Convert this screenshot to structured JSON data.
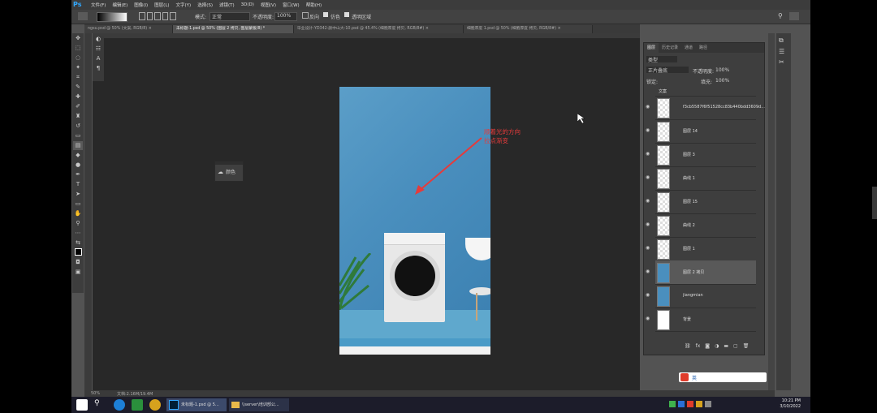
{
  "app": {
    "name": "Ps"
  },
  "menu": [
    "文件(F)",
    "编辑(E)",
    "图像(I)",
    "图层(L)",
    "文字(Y)",
    "选择(S)",
    "滤镜(T)",
    "3D(D)",
    "视图(V)",
    "窗口(W)",
    "帮助(H)"
  ],
  "options": {
    "mode_label": "模式:",
    "mode_value": "正常",
    "opacity_label": "不透明度:",
    "opacity_value": "100%",
    "reverse": "反向",
    "dither": "仿色",
    "transparency": "透明区域"
  },
  "tabs": [
    {
      "label": "ngsu.psd @ 50% (文案, RGB/8) ×",
      "active": false
    },
    {
      "label": "未标题-1.psd @ 50% (图层 2 拷贝, 图层蒙版/8) *",
      "active": true
    },
    {
      "label": "毕业设计-YD342-颜中山大-10.psd @ 45.4% (细胞厚度 拷贝, RGB/8#) ×",
      "active": false
    },
    {
      "label": "细胞厚度 1.psd @ 50% (细胞厚度 拷贝, RGB/8#) ×",
      "active": false
    }
  ],
  "canvas_annotation": {
    "line1": "顺着光的方向",
    "line2": "拉点渐变"
  },
  "color_panel": {
    "label": "颜色"
  },
  "layers_panel": {
    "tabs": [
      "图层",
      "历史记录",
      "通道",
      "路径"
    ],
    "kind_label": "类型",
    "blend_mode": "正片叠底",
    "opacity_label": "不透明度:",
    "opacity_value": "100%",
    "lock_label": "锁定:",
    "fill_label": "填充:",
    "fill_value": "100%",
    "layers": [
      {
        "name": "文案",
        "type": "group"
      },
      {
        "name": "f3cb5587f6f51528cc83b440bdd3609d..."
      },
      {
        "name": "图层 14"
      },
      {
        "name": "图层 3"
      },
      {
        "name": "曲线 1"
      },
      {
        "name": "图层 15"
      },
      {
        "name": "曲线 2"
      },
      {
        "name": "图层 1"
      },
      {
        "name": "图层 2 拷贝",
        "selected": true
      },
      {
        "name": "jiangmian"
      },
      {
        "name": "背景"
      }
    ]
  },
  "status": {
    "zoom": "50%",
    "doc": "文档:2.16M/19.4M"
  },
  "taskbar": {
    "ps_label": "未标题-1.psd @ 5...",
    "folder_label": "\\\\server\\培训部公...",
    "time": "10:21 PM",
    "date": "3/10/2022",
    "ime": "英"
  }
}
